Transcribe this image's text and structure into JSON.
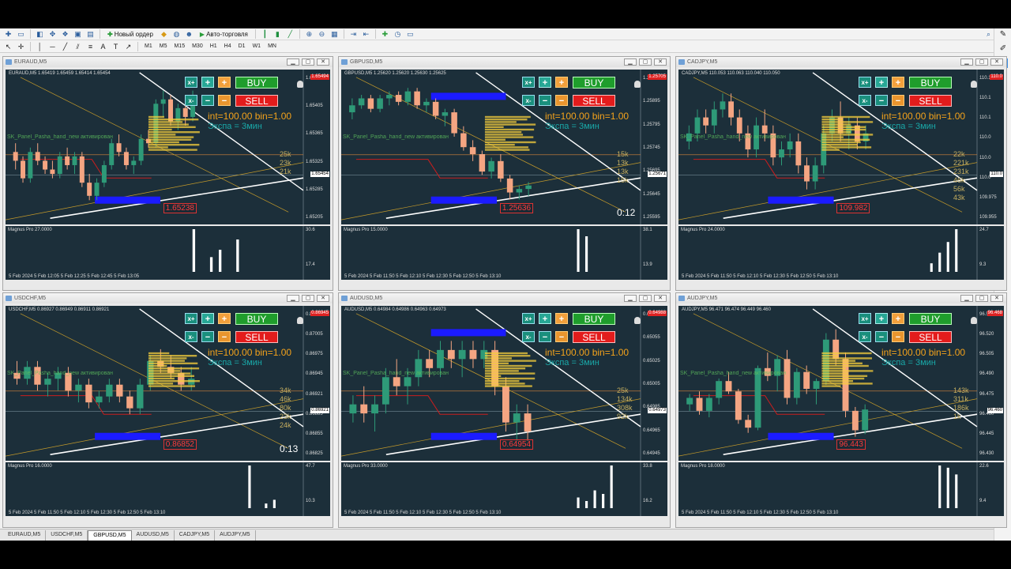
{
  "toolbar": {
    "new_order": "Новый ордер",
    "auto_trading": "Авто-торговля",
    "timeframes": [
      "M1",
      "M5",
      "M15",
      "M30",
      "H1",
      "H4",
      "D1",
      "W1",
      "MN"
    ]
  },
  "tabs": [
    "EURAUD,M5",
    "USDCHF,M5",
    "GBPUSD,M5",
    "AUDUSD,M5",
    "CADJPY,M5",
    "AUDJPY,M5"
  ],
  "active_tab": "GBPUSD,M5",
  "panel": {
    "xplus": "x+",
    "xminus": "x-",
    "plus": "+",
    "minus": "−",
    "buy": "BUY",
    "sell": "SELL",
    "int_text": "int=100.00 bin=1.00",
    "expa_text": "Экспа = 3мин",
    "side_text": "SK_Panel_Pasha_hand_new активирован"
  },
  "windows": [
    {
      "title": "EURAUD,M5",
      "symbol_line": "EURAUD,M5  1.65419 1.65459 1.65414 1.65454",
      "price_ticks": [
        "1.65465",
        "1.65405",
        "1.65365",
        "1.65325",
        "1.65285",
        "1.65205"
      ],
      "red_tag": "1.65494",
      "cur_price": "1.65454",
      "price_label": "1.65238",
      "vol_labels": [
        "25k",
        "23k",
        "21k"
      ],
      "timer": "",
      "indicator": "Magnus Pro 27.0000",
      "ind_max": "30.6",
      "ind_min": "17.4",
      "time_axis": "5 Feb 2024    5 Feb 12:05    5 Feb 12:25    5 Feb 12:45    5 Feb 13:05",
      "candles": [
        [
          1.6532,
          1.6534,
          1.6528,
          1.653
        ],
        [
          1.653,
          1.6531,
          1.6525,
          1.6526
        ],
        [
          1.6526,
          1.6533,
          1.6525,
          1.6532
        ],
        [
          1.6532,
          1.6534,
          1.6529,
          1.653
        ],
        [
          1.653,
          1.6531,
          1.6527,
          1.6528
        ],
        [
          1.6528,
          1.653,
          1.6526,
          1.6527
        ],
        [
          1.6527,
          1.6532,
          1.6526,
          1.6531
        ],
        [
          1.6531,
          1.6533,
          1.6528,
          1.6529
        ],
        [
          1.6529,
          1.6532,
          1.6527,
          1.6531
        ],
        [
          1.6531,
          1.6532,
          1.6524,
          1.6525
        ],
        [
          1.6525,
          1.6527,
          1.6521,
          1.6522
        ],
        [
          1.6522,
          1.6526,
          1.6521,
          1.6525
        ],
        [
          1.6525,
          1.653,
          1.6524,
          1.6529
        ],
        [
          1.6529,
          1.6535,
          1.6528,
          1.6534
        ],
        [
          1.6534,
          1.6536,
          1.6531,
          1.6532
        ],
        [
          1.6532,
          1.6533,
          1.6528,
          1.6529
        ],
        [
          1.6529,
          1.6531,
          1.6527,
          1.653
        ],
        [
          1.653,
          1.6536,
          1.6529,
          1.6535
        ],
        [
          1.6535,
          1.6537,
          1.6533,
          1.6534
        ],
        [
          1.6534,
          1.6544,
          1.6533,
          1.6543
        ],
        [
          1.6543,
          1.6546,
          1.654,
          1.6544
        ],
        [
          1.6544,
          1.6545,
          1.6538,
          1.6539
        ],
        [
          1.6539,
          1.6543,
          1.6537,
          1.6542
        ],
        [
          1.6542,
          1.6544,
          1.6538,
          1.654
        ],
        [
          1.654,
          1.6546,
          1.6539,
          1.6545
        ]
      ],
      "histogram": [
        0,
        0,
        0,
        0,
        0,
        0,
        0,
        0,
        0,
        0,
        0,
        0,
        0,
        0,
        0,
        0,
        0,
        0,
        0,
        0,
        0,
        29,
        0,
        10,
        15,
        0,
        22,
        0,
        0,
        0,
        0,
        0,
        0,
        0
      ],
      "ylim": [
        1.6518,
        1.6549
      ]
    },
    {
      "title": "GBPUSD,M5",
      "symbol_line": "GBPUSD,M5  1.25620 1.25620 1.25630 1.25625",
      "price_ticks": [
        "1.25945",
        "1.25895",
        "1.25795",
        "1.25745",
        "1.25695",
        "1.25645",
        "1.25595"
      ],
      "red_tag": "1.25705",
      "cur_price": "1.25671",
      "price_label": "1.25636",
      "vol_labels": [
        "15k",
        "13k",
        "13k",
        "15k"
      ],
      "timer": "0:12",
      "indicator": "Magnus Pro 15.0000",
      "ind_max": "38.1",
      "ind_min": "13.9",
      "time_axis": "5 Feb 2024    5 Feb 11:50    5 Feb 12:10    5 Feb 12:30    5 Feb 12:50    5 Feb 13:10",
      "candles": [
        [
          1.2588,
          1.2592,
          1.2586,
          1.259
        ],
        [
          1.259,
          1.2593,
          1.2589,
          1.2592
        ],
        [
          1.2592,
          1.2593,
          1.2588,
          1.2589
        ],
        [
          1.2589,
          1.2593,
          1.2588,
          1.2592
        ],
        [
          1.2592,
          1.2594,
          1.259,
          1.2593
        ],
        [
          1.2593,
          1.2594,
          1.259,
          1.2591
        ],
        [
          1.2591,
          1.2595,
          1.259,
          1.2594
        ],
        [
          1.2594,
          1.2595,
          1.2589,
          1.259
        ],
        [
          1.259,
          1.2592,
          1.2588,
          1.2591
        ],
        [
          1.2591,
          1.2592,
          1.2586,
          1.2587
        ],
        [
          1.2587,
          1.2589,
          1.2584,
          1.2588
        ],
        [
          1.2588,
          1.2589,
          1.2581,
          1.2582
        ],
        [
          1.2582,
          1.2584,
          1.2577,
          1.2578
        ],
        [
          1.2578,
          1.258,
          1.2574,
          1.2576
        ],
        [
          1.2576,
          1.2577,
          1.257,
          1.2571
        ],
        [
          1.2571,
          1.2575,
          1.2569,
          1.2574
        ],
        [
          1.2574,
          1.2576,
          1.2568,
          1.2569
        ],
        [
          1.2569,
          1.257,
          1.2563,
          1.2565
        ],
        [
          1.2565,
          1.2567,
          1.2563,
          1.2566
        ],
        [
          1.2566,
          1.2568,
          1.2564,
          1.2567
        ]
      ],
      "histogram": [
        0,
        0,
        0,
        0,
        0,
        0,
        0,
        0,
        0,
        0,
        0,
        0,
        0,
        0,
        0,
        0,
        0,
        0,
        0,
        0,
        0,
        0,
        0,
        0,
        0,
        0,
        0,
        0,
        36,
        30,
        0,
        0,
        0,
        0,
        0,
        0
      ],
      "ylim": [
        1.2559,
        1.2598
      ]
    },
    {
      "title": "CADJPY,M5",
      "symbol_line": "CADJPY,M5  110.053 110.063 110.040 110.050",
      "price_ticks": [
        "110.1",
        "110.1",
        "110.1",
        "110.0",
        "110.0",
        "110.0",
        "109.975",
        "109.955"
      ],
      "red_tag": "110.0",
      "cur_price": "110.0",
      "price_label": "109.982",
      "vol_labels": [
        "22k",
        "221k",
        "231k",
        "46k",
        "56k",
        "43k"
      ],
      "timer": "",
      "indicator": "Magnus Pro 24.0000",
      "ind_max": "24.7",
      "ind_min": "9.3",
      "time_axis": "5 Feb 2024    5 Feb 11:50    5 Feb 12:10    5 Feb 12:30    5 Feb 12:50    5 Feb 13:10",
      "candles": [
        [
          110.04,
          110.06,
          110.03,
          110.05
        ],
        [
          110.05,
          110.08,
          110.04,
          110.07
        ],
        [
          110.07,
          110.08,
          110.05,
          110.06
        ],
        [
          110.06,
          110.09,
          110.05,
          110.08
        ],
        [
          110.08,
          110.1,
          110.07,
          110.09
        ],
        [
          110.09,
          110.1,
          110.06,
          110.07
        ],
        [
          110.07,
          110.08,
          110.04,
          110.05
        ],
        [
          110.05,
          110.06,
          110.02,
          110.03
        ],
        [
          110.03,
          110.07,
          110.02,
          110.06
        ],
        [
          110.06,
          110.08,
          110.04,
          110.05
        ],
        [
          110.05,
          110.06,
          110.01,
          110.02
        ],
        [
          110.02,
          110.04,
          110.01,
          110.03
        ],
        [
          110.03,
          110.05,
          110.02,
          110.04
        ],
        [
          110.04,
          110.05,
          110.0,
          110.01
        ],
        [
          110.01,
          110.02,
          109.98,
          109.99
        ],
        [
          109.99,
          110.02,
          109.98,
          110.01
        ],
        [
          110.01,
          110.06,
          110.0,
          110.05
        ],
        [
          110.05,
          110.08,
          110.04,
          110.07
        ],
        [
          110.07,
          110.09,
          110.04,
          110.05
        ],
        [
          110.05,
          110.07,
          110.03,
          110.06
        ],
        [
          110.06,
          110.07,
          110.03,
          110.04
        ],
        [
          110.04,
          110.06,
          110.03,
          110.05
        ]
      ],
      "histogram": [
        0,
        0,
        0,
        0,
        0,
        0,
        0,
        0,
        0,
        0,
        0,
        0,
        0,
        0,
        0,
        0,
        0,
        0,
        0,
        0,
        0,
        0,
        0,
        0,
        0,
        0,
        0,
        0,
        0,
        0,
        4,
        9,
        14,
        20,
        0,
        0
      ],
      "ylim": [
        109.95,
        110.12
      ]
    },
    {
      "title": "USDCHF,M5",
      "symbol_line": "USDCHF,M5  0.86927 0.86949 0.86911 0.86921",
      "price_ticks": [
        "0.87035",
        "0.87005",
        "0.86975",
        "0.86945",
        "0.86921",
        "0.86885",
        "0.86855",
        "0.86825"
      ],
      "red_tag": "0.86945",
      "cur_price": "0.86921",
      "price_label": "0.86852",
      "vol_labels": [
        "34k",
        "46k",
        "80k",
        "23k",
        "24k"
      ],
      "timer": "0:13",
      "indicator": "Magnus Pro 16.0000",
      "ind_max": "47.7",
      "ind_min": "10.3",
      "time_axis": "5 Feb 2024    5 Feb 11:50    5 Feb 12:10    5 Feb 12:30    5 Feb 12:50    5 Feb 13:10",
      "candles": [
        [
          0.8695,
          0.8697,
          0.8693,
          0.8694
        ],
        [
          0.8694,
          0.8697,
          0.8693,
          0.8696
        ],
        [
          0.8696,
          0.8697,
          0.8692,
          0.8693
        ],
        [
          0.8693,
          0.8695,
          0.8691,
          0.8694
        ],
        [
          0.8694,
          0.8696,
          0.8692,
          0.8695
        ],
        [
          0.8695,
          0.8696,
          0.8691,
          0.8692
        ],
        [
          0.8692,
          0.8694,
          0.869,
          0.8693
        ],
        [
          0.8693,
          0.8694,
          0.8689,
          0.869
        ],
        [
          0.869,
          0.8692,
          0.8689,
          0.8691
        ],
        [
          0.8691,
          0.8694,
          0.869,
          0.8693
        ],
        [
          0.8693,
          0.8694,
          0.869,
          0.8691
        ],
        [
          0.8691,
          0.8692,
          0.8688,
          0.8689
        ],
        [
          0.8689,
          0.8694,
          0.8688,
          0.8693
        ],
        [
          0.8693,
          0.8698,
          0.8692,
          0.8697
        ],
        [
          0.8697,
          0.8699,
          0.8695,
          0.8696
        ],
        [
          0.8696,
          0.8698,
          0.8694,
          0.8695
        ],
        [
          0.8695,
          0.8696,
          0.8692,
          0.8693
        ],
        [
          0.8693,
          0.8696,
          0.8692,
          0.8694
        ]
      ],
      "histogram": [
        0,
        0,
        0,
        0,
        0,
        0,
        0,
        0,
        0,
        0,
        0,
        0,
        0,
        0,
        0,
        0,
        0,
        0,
        0,
        0,
        0,
        0,
        0,
        0,
        0,
        0,
        0,
        0,
        0,
        46,
        0,
        5,
        9,
        0,
        0,
        0
      ],
      "ylim": [
        0.8682,
        0.8705
      ]
    },
    {
      "title": "AUDUSD,M5",
      "symbol_line": "AUDUSD,M5  0.64984 0.64986 0.64963 0.64973",
      "price_ticks": [
        "0.65085",
        "0.65055",
        "0.65025",
        "0.65005",
        "0.64985",
        "0.64965",
        "0.64945"
      ],
      "red_tag": "0.64988",
      "cur_price": "0.64973",
      "price_label": "0.64954",
      "vol_labels": [
        "25k",
        "134k",
        "308k",
        "92k"
      ],
      "timer": "",
      "indicator": "Magnus Pro 33.0000",
      "ind_max": "33.8",
      "ind_min": "16.2",
      "time_axis": "5 Feb 2024    5 Feb 11:50    5 Feb 12:10    5 Feb 12:30    5 Feb 12:50    5 Feb 13:10",
      "candles": [
        [
          0.6498,
          0.65,
          0.6497,
          0.6499
        ],
        [
          0.6499,
          0.6501,
          0.6497,
          0.6498
        ],
        [
          0.6498,
          0.65,
          0.6496,
          0.6499
        ],
        [
          0.6499,
          0.6503,
          0.6498,
          0.6502
        ],
        [
          0.6502,
          0.6504,
          0.65,
          0.6501
        ],
        [
          0.6501,
          0.6503,
          0.6499,
          0.6502
        ],
        [
          0.6502,
          0.6505,
          0.6501,
          0.6504
        ],
        [
          0.6504,
          0.6505,
          0.6502,
          0.6503
        ],
        [
          0.6503,
          0.6506,
          0.6502,
          0.6505
        ],
        [
          0.6505,
          0.6506,
          0.6503,
          0.6504
        ],
        [
          0.6504,
          0.6506,
          0.6502,
          0.6505
        ],
        [
          0.6505,
          0.6506,
          0.6503,
          0.6504
        ],
        [
          0.6504,
          0.6506,
          0.6503,
          0.6505
        ],
        [
          0.6505,
          0.6506,
          0.65,
          0.6501
        ],
        [
          0.6501,
          0.6502,
          0.6496,
          0.6497
        ],
        [
          0.6497,
          0.6499,
          0.6495,
          0.6498
        ],
        [
          0.6498,
          0.6499,
          0.6495,
          0.6496
        ]
      ],
      "histogram": [
        0,
        0,
        0,
        0,
        0,
        0,
        0,
        0,
        0,
        0,
        0,
        0,
        0,
        0,
        0,
        0,
        0,
        0,
        0,
        0,
        0,
        0,
        0,
        0,
        0,
        0,
        0,
        0,
        6,
        4,
        10,
        8,
        24,
        0,
        0,
        0
      ],
      "ylim": [
        0.6494,
        0.6509
      ]
    },
    {
      "title": "AUDJPY,M5",
      "symbol_line": "AUDJPY,M5  96.471 96.474 96.449 96.460",
      "price_ticks": [
        "96.535",
        "96.520",
        "96.505",
        "96.490",
        "96.475",
        "96.460",
        "96.445",
        "96.430"
      ],
      "red_tag": "96.468",
      "cur_price": "96.460",
      "price_label": "96.443",
      "vol_labels": [
        "143k",
        "311k",
        "186k",
        "1k"
      ],
      "timer": "",
      "indicator": "Magnus Pro 18.0000",
      "ind_max": "22.6",
      "ind_min": "9.4",
      "time_axis": "5 Feb 2024    5 Feb 11:50    5 Feb 12:10    5 Feb 12:30    5 Feb 12:50    5 Feb 13:10",
      "candles": [
        [
          96.47,
          96.478,
          96.465,
          96.475
        ],
        [
          96.475,
          96.48,
          96.462,
          96.465
        ],
        [
          96.465,
          96.478,
          96.46,
          96.475
        ],
        [
          96.475,
          96.49,
          96.47,
          96.488
        ],
        [
          96.488,
          96.495,
          96.478,
          96.48
        ],
        [
          96.48,
          96.482,
          96.455,
          96.458
        ],
        [
          96.458,
          96.462,
          96.448,
          96.452
        ],
        [
          96.452,
          96.5,
          96.45,
          96.498
        ],
        [
          96.498,
          96.51,
          96.488,
          96.492
        ],
        [
          96.492,
          96.508,
          96.48,
          96.505
        ],
        [
          96.505,
          96.512,
          96.47,
          96.475
        ],
        [
          96.475,
          96.498,
          96.47,
          96.495
        ],
        [
          96.495,
          96.5,
          96.478,
          96.482
        ],
        [
          96.482,
          96.49,
          96.47,
          96.488
        ],
        [
          96.488,
          96.525,
          96.485,
          96.52
        ],
        [
          96.52,
          96.528,
          96.5,
          96.505
        ],
        [
          96.505,
          96.51,
          96.46,
          96.465
        ],
        [
          96.465,
          96.468,
          96.445,
          96.45
        ],
        [
          96.45,
          96.47,
          96.447,
          96.466
        ]
      ],
      "histogram": [
        0,
        0,
        0,
        0,
        0,
        0,
        0,
        0,
        0,
        0,
        0,
        0,
        0,
        0,
        0,
        0,
        0,
        0,
        0,
        0,
        0,
        0,
        0,
        0,
        0,
        0,
        0,
        0,
        0,
        0,
        0,
        19,
        18,
        15,
        0,
        0
      ],
      "ylim": [
        96.435,
        96.54
      ]
    }
  ]
}
